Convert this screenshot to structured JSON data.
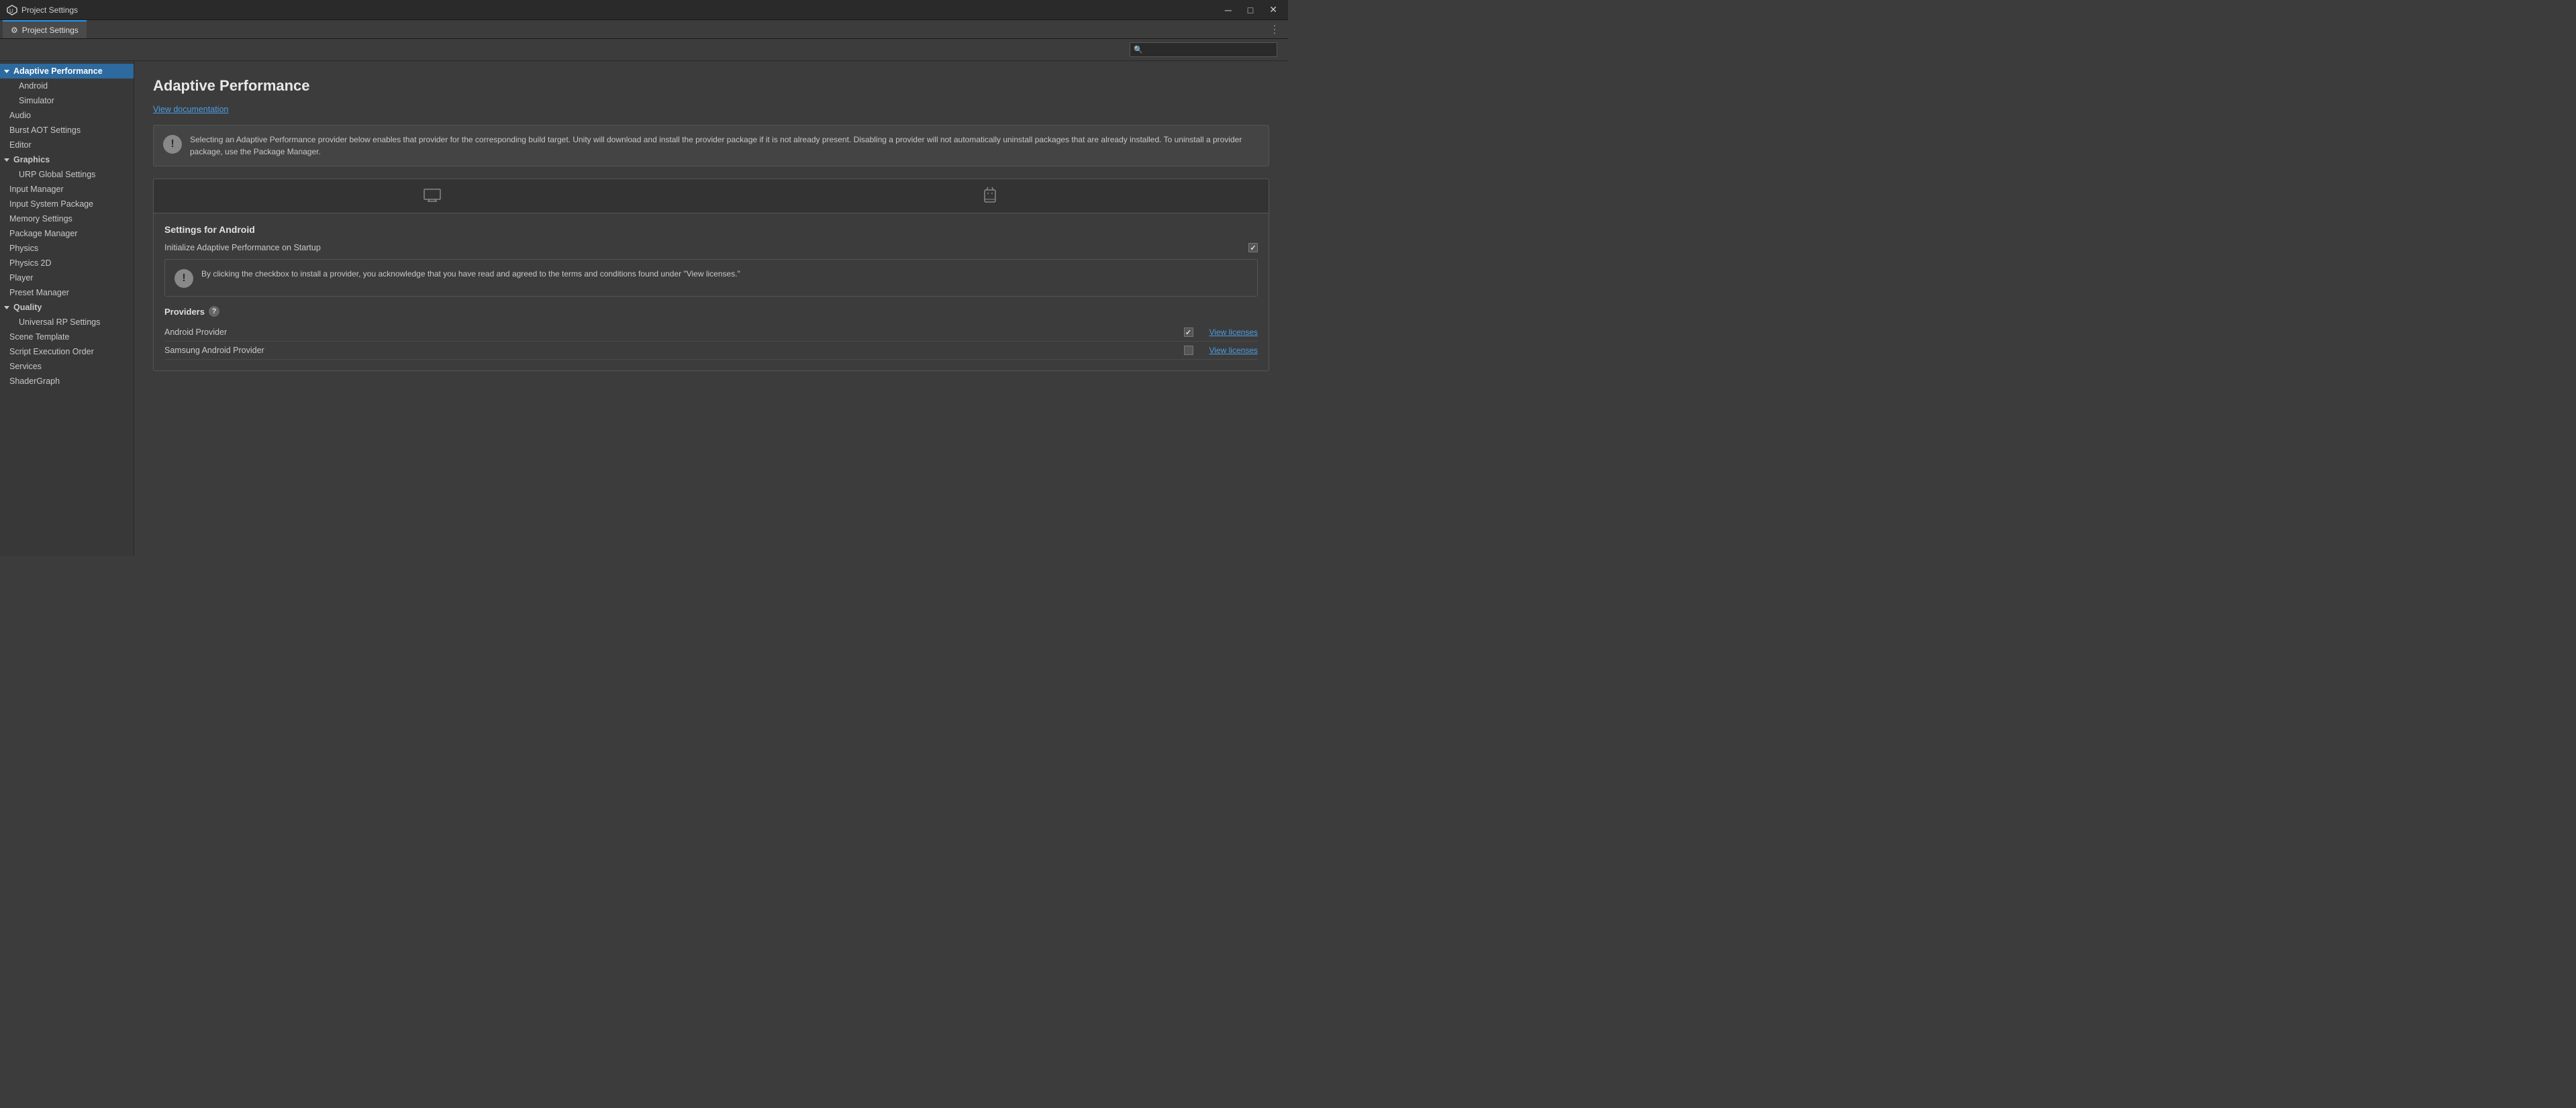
{
  "window": {
    "title": "Project Settings",
    "minimize_btn": "─",
    "restore_btn": "□",
    "close_btn": "✕"
  },
  "tab_bar": {
    "active_tab": "Project Settings",
    "gear_icon": "⚙",
    "more_icon": "⋮"
  },
  "search": {
    "placeholder": ""
  },
  "sidebar": {
    "items": [
      {
        "id": "adaptive-performance",
        "label": "Adaptive Performance",
        "type": "section-header",
        "expanded": true,
        "active": true
      },
      {
        "id": "android",
        "label": "Android",
        "type": "child"
      },
      {
        "id": "simulator",
        "label": "Simulator",
        "type": "child"
      },
      {
        "id": "audio",
        "label": "Audio",
        "type": "item"
      },
      {
        "id": "burst-aot",
        "label": "Burst AOT Settings",
        "type": "item"
      },
      {
        "id": "editor",
        "label": "Editor",
        "type": "item"
      },
      {
        "id": "graphics",
        "label": "Graphics",
        "type": "section-header",
        "expanded": true
      },
      {
        "id": "urp-global",
        "label": "URP Global Settings",
        "type": "child"
      },
      {
        "id": "input-manager",
        "label": "Input Manager",
        "type": "item"
      },
      {
        "id": "input-system",
        "label": "Input System Package",
        "type": "item"
      },
      {
        "id": "memory-settings",
        "label": "Memory Settings",
        "type": "item"
      },
      {
        "id": "package-manager",
        "label": "Package Manager",
        "type": "item"
      },
      {
        "id": "physics",
        "label": "Physics",
        "type": "item"
      },
      {
        "id": "physics-2d",
        "label": "Physics 2D",
        "type": "item"
      },
      {
        "id": "player",
        "label": "Player",
        "type": "item"
      },
      {
        "id": "preset-manager",
        "label": "Preset Manager",
        "type": "item"
      },
      {
        "id": "quality",
        "label": "Quality",
        "type": "section-header",
        "expanded": true
      },
      {
        "id": "universal-rp",
        "label": "Universal RP Settings",
        "type": "child"
      },
      {
        "id": "scene-template",
        "label": "Scene Template",
        "type": "item"
      },
      {
        "id": "script-execution",
        "label": "Script Execution Order",
        "type": "item"
      },
      {
        "id": "services",
        "label": "Services",
        "type": "item"
      },
      {
        "id": "shadergraph",
        "label": "ShaderGraph",
        "type": "item"
      }
    ]
  },
  "content": {
    "title": "Adaptive Performance",
    "view_doc_link": "View documentation",
    "info_text": "Selecting an Adaptive Performance provider below enables that provider for the corresponding build target. Unity will download and install the provider package if it is not already present. Disabling a provider will not automatically uninstall packages that are already installed. To uninstall a provider package, use the Package Manager.",
    "platform_tabs": [
      {
        "id": "desktop",
        "icon": "🖥",
        "label": "Desktop",
        "active": false
      },
      {
        "id": "android",
        "icon": "🤖",
        "label": "Android",
        "active": true
      }
    ],
    "settings_for": "Settings for Android",
    "initialize_label": "Initialize Adaptive Performance on Startup",
    "initialize_checked": true,
    "warning_text": "By clicking the checkbox to install a provider, you acknowledge that you have read and agreed to the terms and conditions found under \"View licenses.\"",
    "providers_title": "Providers",
    "providers": [
      {
        "id": "android-provider",
        "name": "Android Provider",
        "checked": true,
        "view_licenses": "View licenses"
      },
      {
        "id": "samsung-provider",
        "name": "Samsung Android Provider",
        "checked": false,
        "view_licenses": "View licenses"
      }
    ]
  }
}
